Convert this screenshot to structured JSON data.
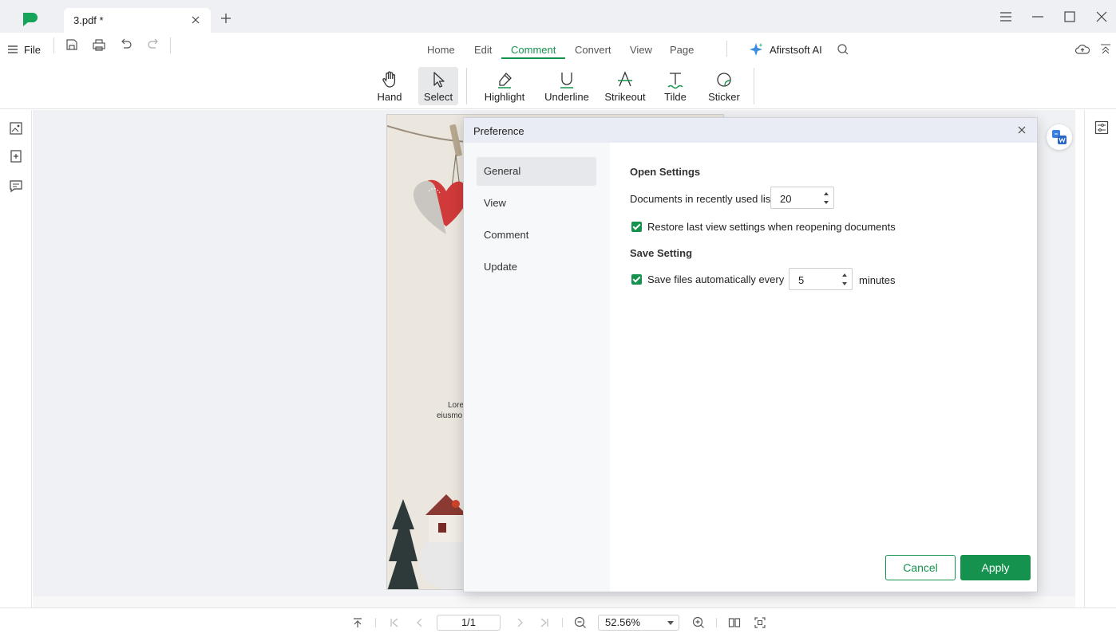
{
  "window": {
    "tab_title": "3.pdf *",
    "accent_color": "#16924f"
  },
  "menu": {
    "file_label": "File",
    "tabs": [
      {
        "label": "Home"
      },
      {
        "label": "Edit"
      },
      {
        "label": "Comment",
        "active": true
      },
      {
        "label": "Convert"
      },
      {
        "label": "View"
      },
      {
        "label": "Page"
      }
    ],
    "ai_label": "Afirstsoft AI"
  },
  "toolbar": {
    "tools": [
      {
        "label": "Hand",
        "icon": "hand-icon"
      },
      {
        "label": "Select",
        "icon": "cursor-icon",
        "active": true
      },
      {
        "label": "Highlight",
        "icon": "highlight-pen-icon"
      },
      {
        "label": "Underline",
        "icon": "underline-icon"
      },
      {
        "label": "Strikeout",
        "icon": "strikeout-icon"
      },
      {
        "label": "Tilde",
        "icon": "tilde-icon"
      },
      {
        "label": "Sticker",
        "icon": "sticker-icon"
      }
    ]
  },
  "document": {
    "text_line1": "Lore",
    "text_line2": "eiusmo"
  },
  "statusbar": {
    "page_indicator": "1/1",
    "zoom": "52.56%"
  },
  "dialog": {
    "title": "Preference",
    "sidebar": [
      {
        "label": "General",
        "active": true
      },
      {
        "label": "View"
      },
      {
        "label": "Comment"
      },
      {
        "label": "Update"
      }
    ],
    "open_settings": {
      "title": "Open Settings",
      "recent_list_label": "Documents in recently used list:",
      "recent_list_value": "20",
      "restore_label": "Restore last view settings when reopening documents",
      "restore_checked": true
    },
    "save_setting": {
      "title": "Save Setting",
      "autosave_label": "Save files automatically every",
      "autosave_checked": true,
      "autosave_value": "5",
      "autosave_unit": "minutes"
    },
    "cancel_label": "Cancel",
    "apply_label": "Apply"
  }
}
